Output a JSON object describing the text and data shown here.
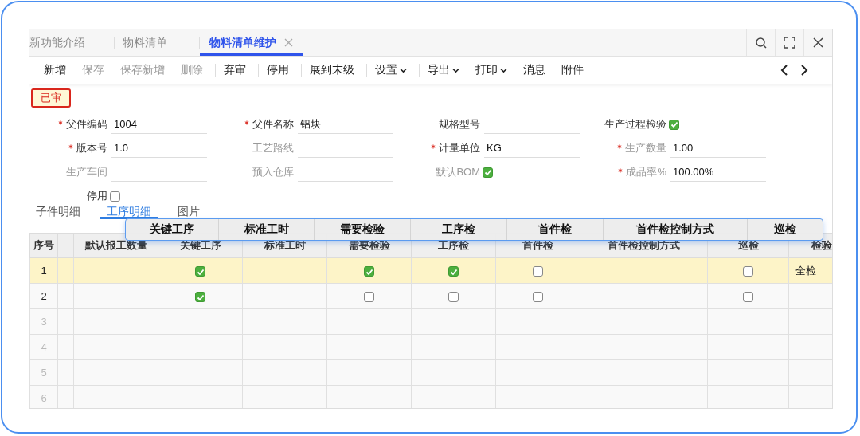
{
  "window_tabs": [
    {
      "label": "新功能介绍",
      "selected": false,
      "closable": false
    },
    {
      "label": "物料清单",
      "selected": false,
      "closable": false
    },
    {
      "label": "物料清单维护",
      "selected": true,
      "closable": true
    }
  ],
  "toolbar": [
    {
      "label": "新增",
      "disabled": false,
      "has_menu": false,
      "separator": false
    },
    {
      "label": "保存",
      "disabled": true,
      "has_menu": false,
      "separator": false
    },
    {
      "label": "保存新增",
      "disabled": true,
      "has_menu": false,
      "separator": false
    },
    {
      "label": "删除",
      "disabled": true,
      "has_menu": false,
      "separator": true
    },
    {
      "label": "弃审",
      "disabled": false,
      "has_menu": false,
      "separator": true
    },
    {
      "label": "停用",
      "disabled": false,
      "has_menu": false,
      "separator": true
    },
    {
      "label": "展到末级",
      "disabled": false,
      "has_menu": false,
      "separator": true
    },
    {
      "label": "设置",
      "disabled": false,
      "has_menu": true,
      "separator": true
    },
    {
      "label": "导出",
      "disabled": false,
      "has_menu": true,
      "separator": false
    },
    {
      "label": "打印",
      "disabled": false,
      "has_menu": true,
      "separator": false
    },
    {
      "label": "消息",
      "disabled": false,
      "has_menu": false,
      "separator": false
    },
    {
      "label": "附件",
      "disabled": false,
      "has_menu": false,
      "separator": false
    }
  ],
  "status_badge": "已审",
  "form_fields": [
    {
      "label": "父件编码",
      "kind": "text",
      "required": true,
      "disabled": false,
      "value": "1004"
    },
    {
      "label": "父件名称",
      "kind": "text",
      "required": true,
      "disabled": false,
      "value": "铝块"
    },
    {
      "label": "规格型号",
      "kind": "text",
      "required": false,
      "disabled": false
    },
    {
      "label": "生产过程检验",
      "kind": "checkbox",
      "required": false,
      "disabled": false,
      "checked": true
    },
    {
      "label": "版本号",
      "kind": "text",
      "required": true,
      "disabled": false,
      "value": "1.0"
    },
    {
      "label": "工艺路线",
      "kind": "text",
      "required": false,
      "disabled": true
    },
    {
      "label": "计量单位",
      "kind": "text",
      "required": true,
      "disabled": false,
      "value": "KG"
    },
    {
      "label": "生产数量",
      "kind": "text",
      "required": true,
      "disabled": true,
      "value": "1.00"
    },
    {
      "label": "生产车间",
      "kind": "text",
      "required": false,
      "disabled": true
    },
    {
      "label": "预入仓库",
      "kind": "text",
      "required": false,
      "disabled": true
    },
    {
      "label": "默认BOM",
      "kind": "checkbox",
      "required": false,
      "disabled": true,
      "checked": true
    },
    {
      "label": "成品率%",
      "kind": "text",
      "required": true,
      "disabled": true,
      "value": "100.00%"
    },
    {
      "label": "停用",
      "kind": "checkbox",
      "required": false,
      "disabled": false,
      "checked": false
    }
  ],
  "detail_tabs": [
    {
      "label": "子件明细",
      "selected": false
    },
    {
      "label": "工序明细",
      "selected": true
    },
    {
      "label": "图片",
      "selected": false
    }
  ],
  "dragged_headers": [
    "关键工序",
    "标准工时",
    "需要检验",
    "工序检",
    "首件检",
    "首件检控制方式",
    "巡检"
  ],
  "table": {
    "columns": [
      {
        "label": "序号",
        "kind": "number"
      },
      {
        "kind": "blank"
      },
      {
        "label": "默认报工数量",
        "kind": "text"
      },
      {
        "label": "关键工序",
        "kind": "check"
      },
      {
        "label": "标准工时",
        "kind": "text"
      },
      {
        "label": "需要检验",
        "kind": "check"
      },
      {
        "label": "工序检",
        "kind": "check"
      },
      {
        "label": "首件检",
        "kind": "check"
      },
      {
        "label": "首件检控制方式",
        "kind": "text"
      },
      {
        "label": "巡检",
        "kind": "check"
      },
      {
        "label": "检验",
        "kind": "text"
      }
    ],
    "rows": [
      {
        "number": "1",
        "selected": true,
        "cells": [
          null,
          null,
          true,
          null,
          true,
          true,
          false,
          null,
          false,
          "全检"
        ]
      },
      {
        "number": "2",
        "selected": false,
        "cells": [
          null,
          null,
          true,
          null,
          false,
          false,
          false,
          null,
          false,
          null
        ]
      },
      {
        "number": "3",
        "selected": false
      },
      {
        "number": "4",
        "selected": false
      },
      {
        "number": "5",
        "selected": false
      },
      {
        "number": "6",
        "selected": false
      }
    ]
  }
}
